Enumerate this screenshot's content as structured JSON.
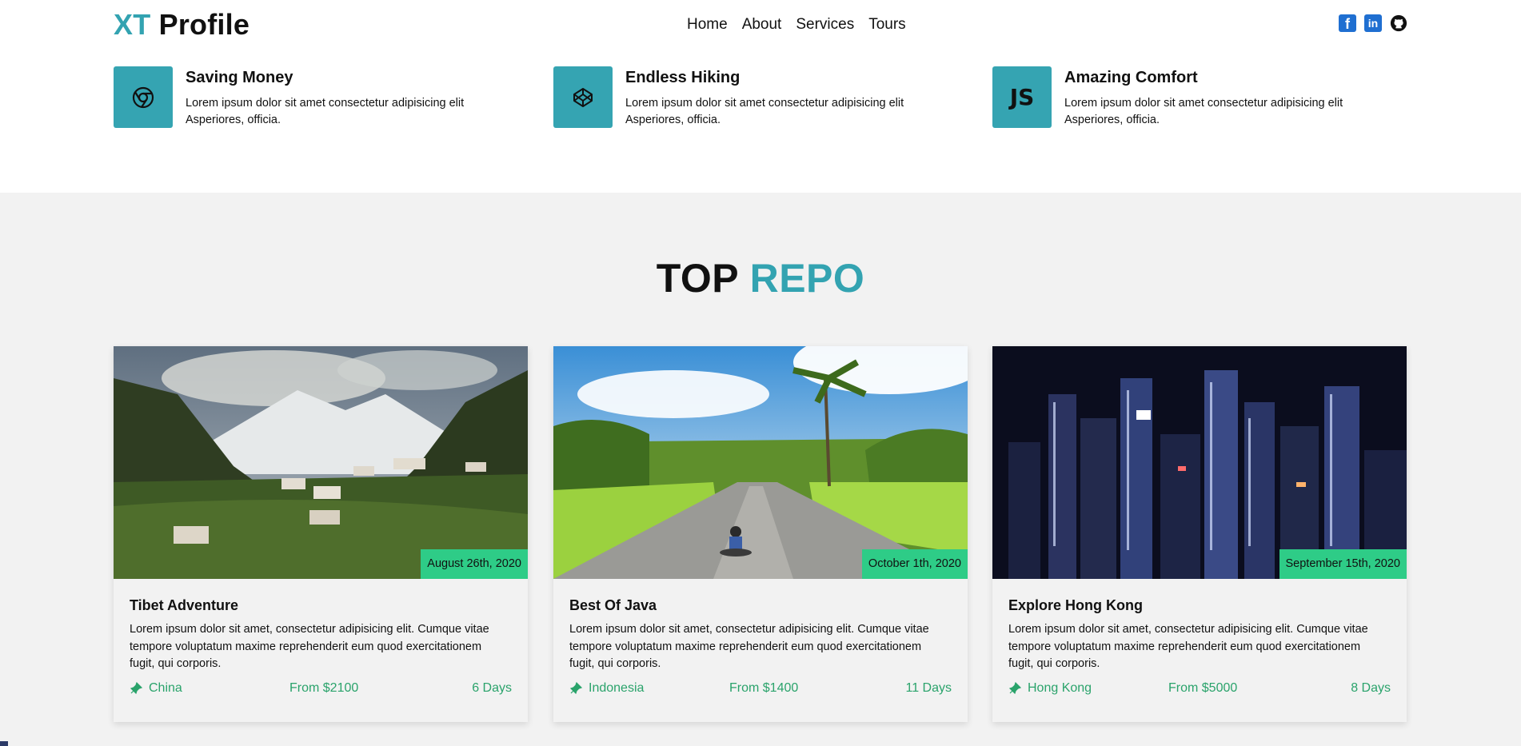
{
  "header": {
    "logo_accent": "XT",
    "logo_rest": "Profile",
    "nav": [
      "Home",
      "About",
      "Services",
      "Tours"
    ],
    "social_icons": [
      "facebook-icon",
      "linkedin-icon",
      "github-icon"
    ]
  },
  "features": [
    {
      "icon": "chrome-icon",
      "title": "Saving Money",
      "desc_line1": "Lorem ipsum dolor sit amet consectetur adipisicing elit",
      "desc_line2": "Asperiores, officia."
    },
    {
      "icon": "codepen-icon",
      "title": "Endless Hiking",
      "desc_line1": "Lorem ipsum dolor sit amet consectetur adipisicing elit",
      "desc_line2": "Asperiores, officia."
    },
    {
      "icon": "js-icon",
      "title": "Amazing Comfort",
      "desc_line1": "Lorem ipsum dolor sit amet consectetur adipisicing elit",
      "desc_line2": "Asperiores, officia."
    }
  ],
  "section": {
    "title_main": "TOP",
    "title_accent": "REPO"
  },
  "cards": [
    {
      "date": "August 26th, 2020",
      "title": "Tibet Adventure",
      "desc_l1": "Lorem ipsum dolor sit amet, consectetur adipisicing elit. Cumque vitae",
      "desc_l2": "tempore voluptatum maxime reprehenderit eum quod exercitationem",
      "desc_l3": "fugit, qui corporis.",
      "location": "China",
      "price": "From $2100",
      "days": "6 Days"
    },
    {
      "date": "October 1th, 2020",
      "title": "Best Of Java",
      "desc_l1": "Lorem ipsum dolor sit amet, consectetur adipisicing elit. Cumque vitae",
      "desc_l2": "tempore voluptatum maxime reprehenderit eum quod exercitationem",
      "desc_l3": "fugit, qui corporis.",
      "location": "Indonesia",
      "price": "From $1400",
      "days": "11 Days"
    },
    {
      "date": "September 15th, 2020",
      "title": "Explore Hong Kong",
      "desc_l1": "Lorem ipsum dolor sit amet, consectetur adipisicing elit. Cumque vitae",
      "desc_l2": "tempore voluptatum maxime reprehenderit eum quod exercitationem",
      "desc_l3": "fugit, qui corporis.",
      "location": "Hong Kong",
      "price": "From $5000",
      "days": "8 Days"
    }
  ],
  "colors": {
    "accent": "#33a3b1",
    "badge": "#2ecc87",
    "meta_text": "#2aa36b",
    "section_bg": "#f2f2f2"
  }
}
